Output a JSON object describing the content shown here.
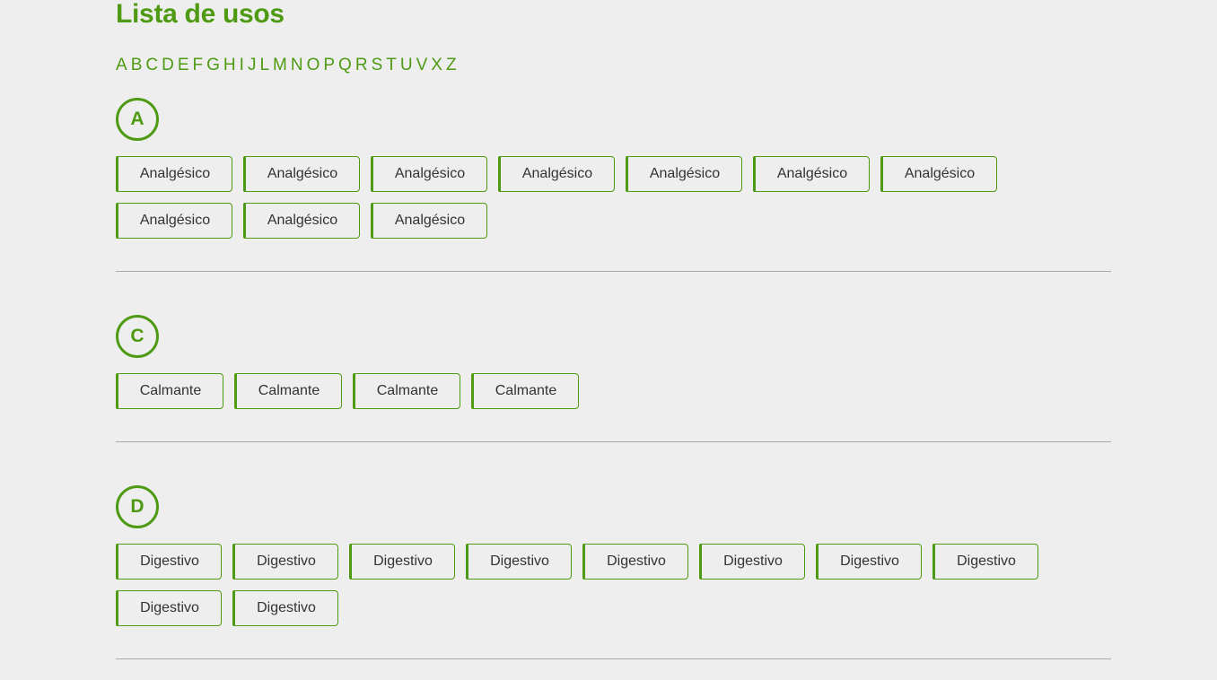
{
  "page_title": "Lista de usos",
  "alphabet": [
    "A",
    "B",
    "C",
    "D",
    "E",
    "F",
    "G",
    "H",
    "I",
    "J",
    "L",
    "M",
    "N",
    "O",
    "P",
    "Q",
    "R",
    "S",
    "T",
    "U",
    "V",
    "X",
    "Z"
  ],
  "sections": [
    {
      "letter": "A",
      "items": [
        "Analgésico",
        "Analgésico",
        "Analgésico",
        "Analgésico",
        "Analgésico",
        "Analgésico",
        "Analgésico",
        "Analgésico",
        "Analgésico",
        "Analgésico"
      ]
    },
    {
      "letter": "C",
      "items": [
        "Calmante",
        "Calmante",
        "Calmante",
        "Calmante"
      ]
    },
    {
      "letter": "D",
      "items": [
        "Digestivo",
        "Digestivo",
        "Digestivo",
        "Digestivo",
        "Digestivo",
        "Digestivo",
        "Digestivo",
        "Digestivo",
        "Digestivo",
        "Digestivo"
      ]
    }
  ],
  "colors": {
    "accent": "#4e9a12",
    "background": "#eeeeee",
    "text": "#333333",
    "divider": "#a9a9a9"
  }
}
